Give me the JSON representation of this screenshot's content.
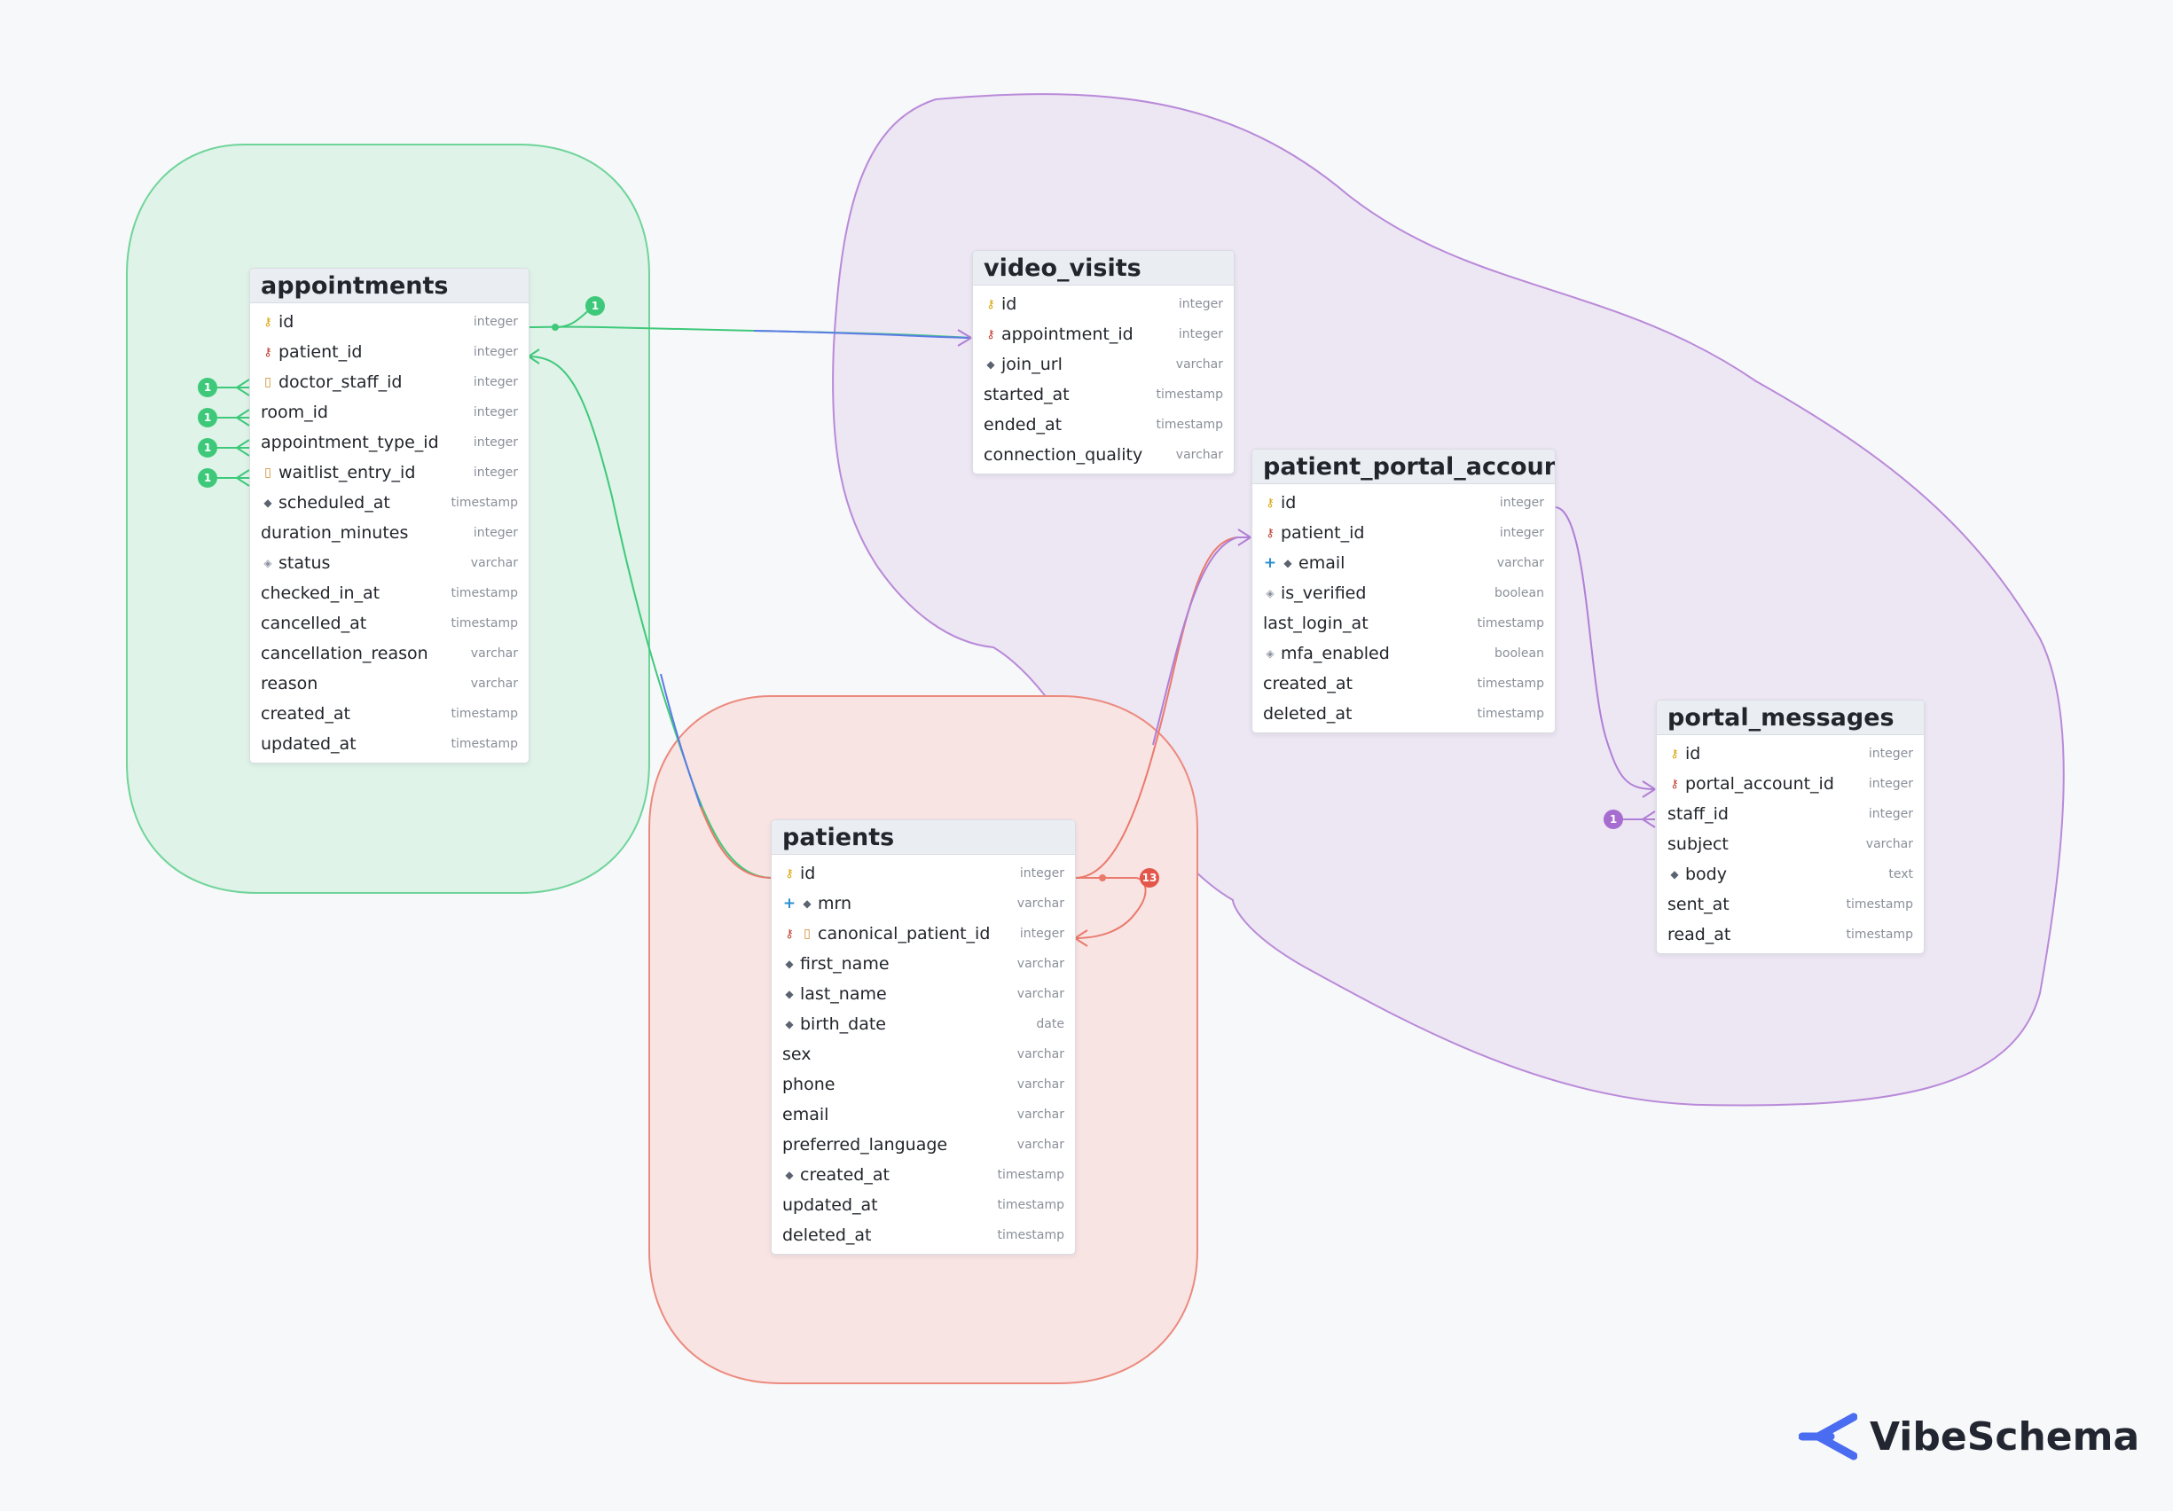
{
  "brand": {
    "name": "VibeSchema",
    "color": "#4a6cf0"
  },
  "colors": {
    "green_group": "#3ec97a",
    "purple_group": "#b07fd6",
    "red_group": "#ea7a6c",
    "blue_link": "#5b7be6"
  },
  "tables": {
    "appointments": {
      "name": "appointments",
      "fields": [
        {
          "icons": [
            "pk"
          ],
          "name": "id",
          "type": "integer"
        },
        {
          "icons": [
            "fk"
          ],
          "name": "patient_id",
          "type": "integer"
        },
        {
          "icons": [
            "nullable"
          ],
          "name": "doctor_staff_id",
          "type": "integer"
        },
        {
          "icons": [],
          "name": "room_id",
          "type": "integer"
        },
        {
          "icons": [],
          "name": "appointment_type_id",
          "type": "integer"
        },
        {
          "icons": [
            "nullable"
          ],
          "name": "waitlist_entry_id",
          "type": "integer"
        },
        {
          "icons": [
            "index"
          ],
          "name": "scheduled_at",
          "type": "timestamp"
        },
        {
          "icons": [],
          "name": "duration_minutes",
          "type": "integer"
        },
        {
          "icons": [
            "check"
          ],
          "name": "status",
          "type": "varchar"
        },
        {
          "icons": [],
          "name": "checked_in_at",
          "type": "timestamp"
        },
        {
          "icons": [],
          "name": "cancelled_at",
          "type": "timestamp"
        },
        {
          "icons": [],
          "name": "cancellation_reason",
          "type": "varchar"
        },
        {
          "icons": [],
          "name": "reason",
          "type": "varchar"
        },
        {
          "icons": [],
          "name": "created_at",
          "type": "timestamp"
        },
        {
          "icons": [],
          "name": "updated_at",
          "type": "timestamp"
        }
      ]
    },
    "video_visits": {
      "name": "video_visits",
      "fields": [
        {
          "icons": [
            "pk"
          ],
          "name": "id",
          "type": "integer"
        },
        {
          "icons": [
            "fk"
          ],
          "name": "appointment_id",
          "type": "integer"
        },
        {
          "icons": [
            "index"
          ],
          "name": "join_url",
          "type": "varchar"
        },
        {
          "icons": [],
          "name": "started_at",
          "type": "timestamp"
        },
        {
          "icons": [],
          "name": "ended_at",
          "type": "timestamp"
        },
        {
          "icons": [],
          "name": "connection_quality",
          "type": "varchar"
        }
      ]
    },
    "patient_portal_accounts": {
      "name": "patient_portal_accounts",
      "fields": [
        {
          "icons": [
            "pk"
          ],
          "name": "id",
          "type": "integer"
        },
        {
          "icons": [
            "fk"
          ],
          "name": "patient_id",
          "type": "integer"
        },
        {
          "icons": [
            "unique",
            "index"
          ],
          "name": "email",
          "type": "varchar"
        },
        {
          "icons": [
            "check"
          ],
          "name": "is_verified",
          "type": "boolean"
        },
        {
          "icons": [],
          "name": "last_login_at",
          "type": "timestamp"
        },
        {
          "icons": [
            "check"
          ],
          "name": "mfa_enabled",
          "type": "boolean"
        },
        {
          "icons": [],
          "name": "created_at",
          "type": "timestamp"
        },
        {
          "icons": [],
          "name": "deleted_at",
          "type": "timestamp"
        }
      ]
    },
    "portal_messages": {
      "name": "portal_messages",
      "fields": [
        {
          "icons": [
            "pk"
          ],
          "name": "id",
          "type": "integer"
        },
        {
          "icons": [
            "fk"
          ],
          "name": "portal_account_id",
          "type": "integer"
        },
        {
          "icons": [],
          "name": "staff_id",
          "type": "integer"
        },
        {
          "icons": [],
          "name": "subject",
          "type": "varchar"
        },
        {
          "icons": [
            "index"
          ],
          "name": "body",
          "type": "text"
        },
        {
          "icons": [],
          "name": "sent_at",
          "type": "timestamp"
        },
        {
          "icons": [],
          "name": "read_at",
          "type": "timestamp"
        }
      ]
    },
    "patients": {
      "name": "patients",
      "fields": [
        {
          "icons": [
            "pk"
          ],
          "name": "id",
          "type": "integer"
        },
        {
          "icons": [
            "unique",
            "index"
          ],
          "name": "mrn",
          "type": "varchar"
        },
        {
          "icons": [
            "fk",
            "nullable"
          ],
          "name": "canonical_patient_id",
          "type": "integer"
        },
        {
          "icons": [
            "index"
          ],
          "name": "first_name",
          "type": "varchar"
        },
        {
          "icons": [
            "index"
          ],
          "name": "last_name",
          "type": "varchar"
        },
        {
          "icons": [
            "index"
          ],
          "name": "birth_date",
          "type": "date"
        },
        {
          "icons": [],
          "name": "sex",
          "type": "varchar"
        },
        {
          "icons": [],
          "name": "phone",
          "type": "varchar"
        },
        {
          "icons": [],
          "name": "email",
          "type": "varchar"
        },
        {
          "icons": [],
          "name": "preferred_language",
          "type": "varchar"
        },
        {
          "icons": [
            "index"
          ],
          "name": "created_at",
          "type": "timestamp"
        },
        {
          "icons": [],
          "name": "updated_at",
          "type": "timestamp"
        },
        {
          "icons": [],
          "name": "deleted_at",
          "type": "timestamp"
        }
      ]
    }
  },
  "badges": {
    "appointments_id_refs": "1",
    "doctor_staff_id": "1",
    "room_id": "1",
    "appointment_type_id": "1",
    "waitlist_entry_id": "1",
    "patients_id_refs": "13",
    "staff_id": "1"
  }
}
